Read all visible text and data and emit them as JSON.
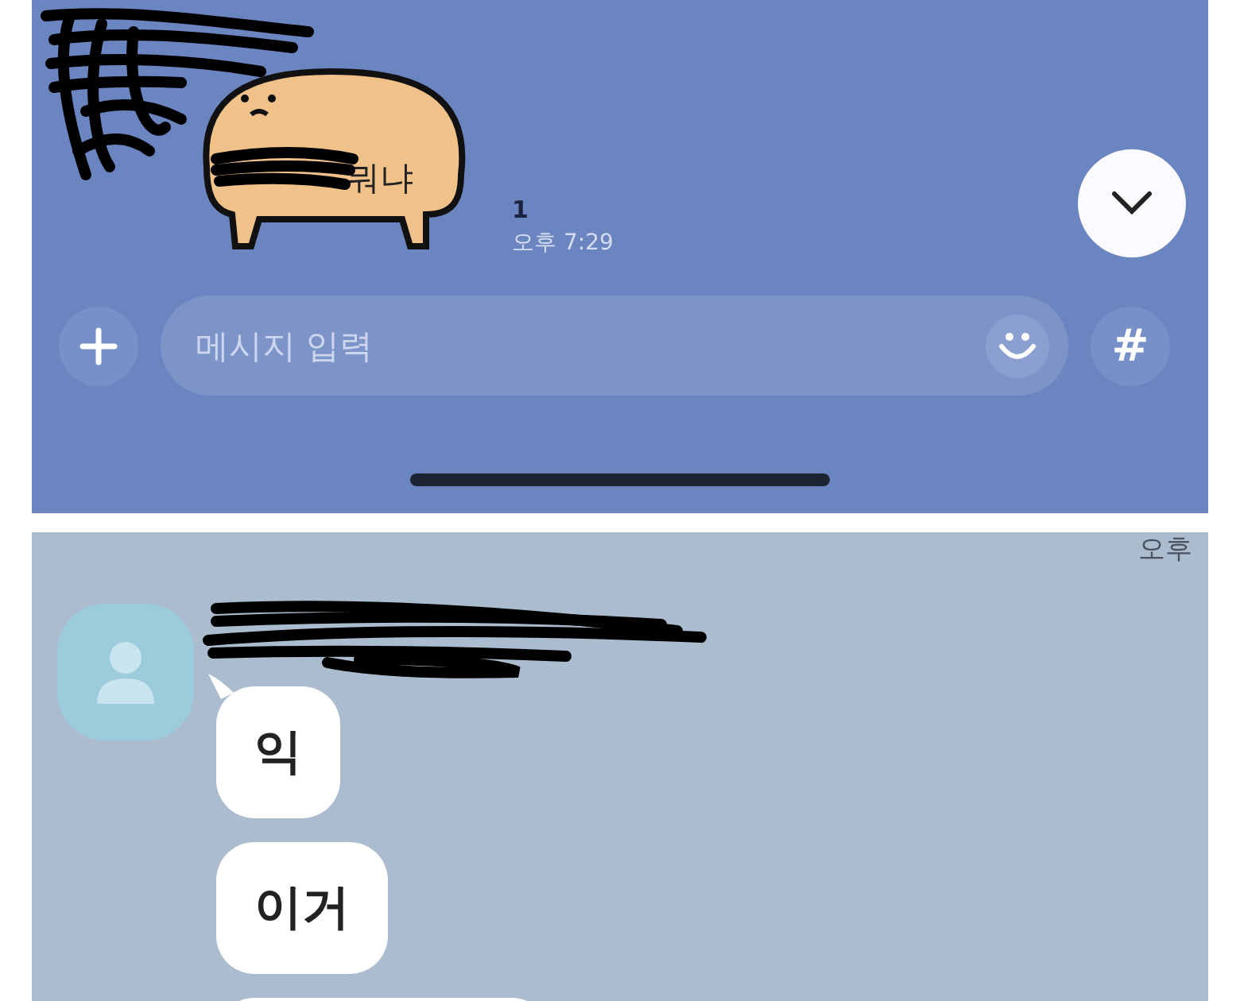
{
  "top_chat": {
    "sticker_caption": "뭐냐",
    "unread_count": "1",
    "time": "오후 7:29",
    "input": {
      "placeholder": "메시지 입력"
    },
    "hash_button": "#"
  },
  "bottom_chat": {
    "time_cut": "오후",
    "messages": [
      {
        "text": "익"
      },
      {
        "text": "이거"
      }
    ]
  }
}
